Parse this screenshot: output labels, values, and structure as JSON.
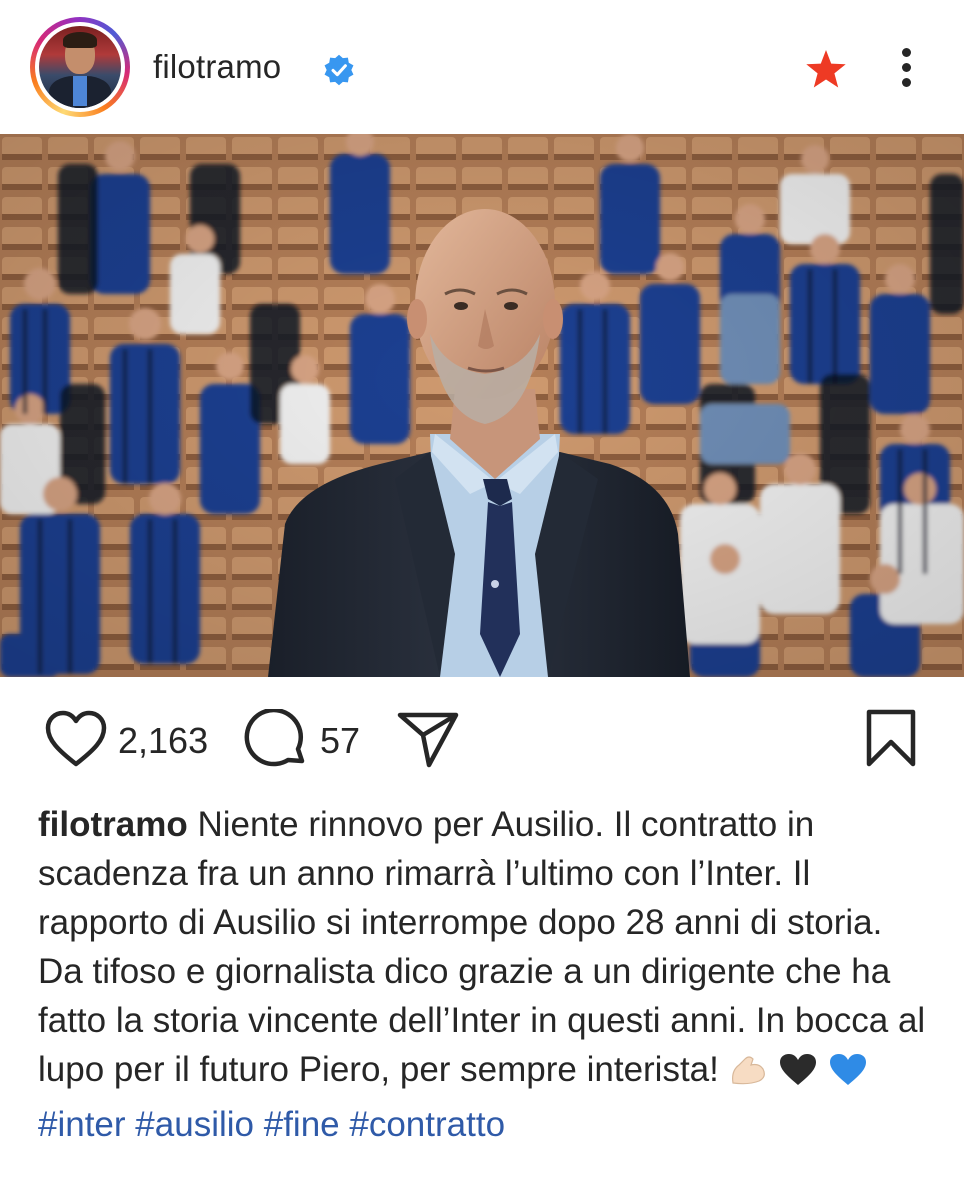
{
  "header": {
    "username": "filotramo",
    "verified": true,
    "favorite_icon": "star-icon",
    "more_icon": "more-vertical-icon",
    "accent_star_color": "#ee3a24",
    "verified_color": "#3897f0"
  },
  "post": {
    "image_description_icon": "post-photo",
    "likes": "2,163",
    "comments": "57",
    "icons": [
      "heart-icon",
      "comment-icon",
      "share-icon",
      "bookmark-icon"
    ]
  },
  "caption": {
    "username": "filotramo",
    "text": "Niente rinnovo per Ausilio. Il contratto in scadenza fra un anno rimarrà l’ultimo con l’Inter. Il rapporto di Ausilio si interrompe dopo 28 anni di storia. Da tifoso e giornalista dico grazie a un dirigente che ha fatto la storia vincente dell’Inter in questi anni. In bocca al lupo per il futuro Piero, per sempre interista!",
    "emojis": [
      "flexed-biceps-emoji",
      "black-heart-emoji",
      "blue-heart-emoji"
    ],
    "hashtags": [
      "#inter",
      "#ausilio",
      "#fine",
      "#contratto"
    ]
  }
}
